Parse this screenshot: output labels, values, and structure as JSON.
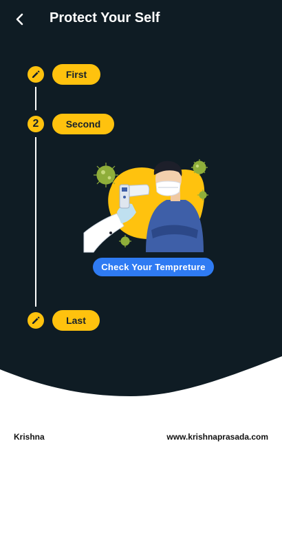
{
  "app_bar": {
    "title": "Protect Your Self",
    "back_icon": "arrow-back-icon"
  },
  "colors": {
    "background": "#0f1c24",
    "accent": "#ffc20e",
    "button": "#2f7bf3"
  },
  "steps": [
    {
      "marker_icon": "pencil-icon",
      "label": "First"
    },
    {
      "marker_text": "2",
      "label": "Second"
    },
    {
      "marker_icon": "pencil-icon",
      "label": "Last"
    }
  ],
  "content": {
    "illustration": "temperature-check-illustration",
    "button_label": "Check Your Tempreture"
  },
  "footer": {
    "left": "Krishna",
    "right": "www.krishnaprasada.com"
  }
}
